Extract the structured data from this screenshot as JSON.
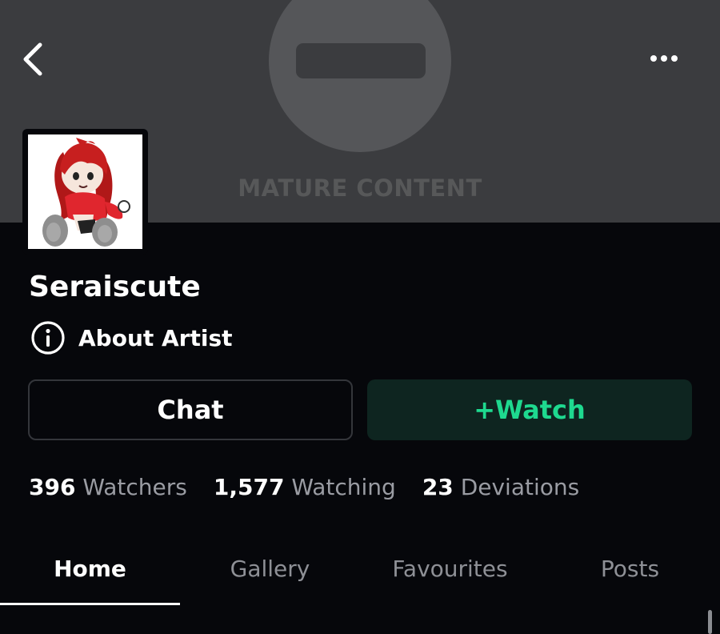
{
  "banner": {
    "mature_label": "MATURE CONTENT"
  },
  "header": {
    "back_icon": "chevron-left-icon",
    "more_icon": "more-horizontal-icon"
  },
  "profile": {
    "username": "Seraiscute",
    "about_label": "About Artist",
    "about_icon": "info-circle-icon"
  },
  "actions": {
    "chat_label": "Chat",
    "watch_label": "+Watch"
  },
  "stats": [
    {
      "value": "396",
      "label": "Watchers"
    },
    {
      "value": "1,577",
      "label": "Watching"
    },
    {
      "value": "23",
      "label": "Deviations"
    }
  ],
  "tabs": [
    {
      "label": "Home",
      "active": true
    },
    {
      "label": "Gallery",
      "active": false
    },
    {
      "label": "Favourites",
      "active": false
    },
    {
      "label": "Posts",
      "active": false
    }
  ],
  "colors": {
    "background": "#06070b",
    "banner": "#3b3c3f",
    "watch_accent": "#1ed98f",
    "watch_bg": "#0e2520",
    "muted_text": "#9a9ca3"
  }
}
